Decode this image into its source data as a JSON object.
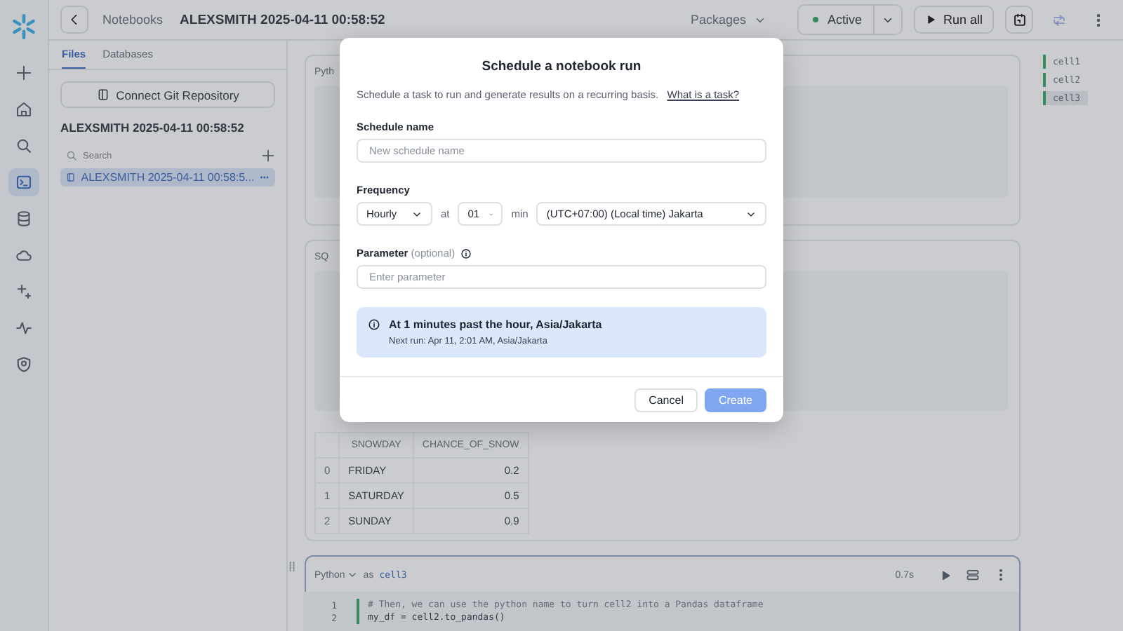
{
  "rail": [
    {
      "selected": false
    },
    {
      "selected": false
    },
    {
      "selected": false
    },
    {
      "selected": true
    },
    {
      "selected": false
    },
    {
      "selected": false
    },
    {
      "selected": false
    },
    {
      "selected": false
    },
    {
      "selected": false
    }
  ],
  "topbar": {
    "breadcrumb": "Notebooks",
    "title": "ALEXSMITH 2025-04-11 00:58:52",
    "packages": "Packages",
    "status": "Active",
    "run_all": "Run all"
  },
  "files_panel": {
    "tabs": [
      {
        "label": "Files",
        "selected": true
      },
      {
        "label": "Databases",
        "selected": false
      }
    ],
    "connect_button": "Connect Git Repository",
    "heading": "ALEXSMITH 2025-04-11 00:58:52",
    "search": {
      "placeholder": "Search"
    },
    "files": [
      {
        "name": "ALEXSMITH 2025-04-11 00:58:5...",
        "selected": true
      }
    ]
  },
  "cells": [
    {
      "kind": "python",
      "language": "Pyth"
    },
    {
      "kind": "sql",
      "language": "SQ",
      "table": {
        "columns": [
          "",
          "SNOWDAY",
          "CHANCE_OF_SNOW"
        ],
        "rows": [
          [
            "0",
            "FRIDAY",
            "0.2"
          ],
          [
            "1",
            "SATURDAY",
            "0.5"
          ],
          [
            "2",
            "SUNDAY",
            "0.9"
          ]
        ]
      }
    },
    {
      "kind": "python",
      "language": "Python",
      "as": "as",
      "name": "cell3",
      "time": "0.7s",
      "lines": [
        {
          "number": "1",
          "code": "# Then, we can use the python name to turn cell2 into a Pandas dataframe"
        },
        {
          "number": "2",
          "code": "my_df = cell2.to_pandas()"
        }
      ]
    }
  ],
  "outline": [
    {
      "label": "cell1",
      "selected": false
    },
    {
      "label": "cell2",
      "selected": false
    },
    {
      "label": "cell3",
      "selected": true
    }
  ],
  "dialog": {
    "title": "Schedule a notebook run",
    "description": "Schedule a task to run and generate results on a recurring basis.",
    "link": "What is a task?",
    "name_label": "Schedule name",
    "name_placeholder": "New schedule name",
    "frequency_label": "Frequency",
    "frequency": "Hourly",
    "at": "at",
    "minute": "01",
    "min": "min",
    "timezone": "(UTC+07:00) (Local time) Jakarta",
    "parameter_label": "Parameter",
    "parameter_optional": "(optional)",
    "parameter_placeholder": "Enter parameter",
    "summary": "At 1 minutes past the hour, Asia/Jakarta",
    "next_run": "Next run: Apr 11, 2:01 AM, Asia/Jakarta",
    "cancel": "Cancel",
    "create": "Create",
    "create_disabled": true
  }
}
